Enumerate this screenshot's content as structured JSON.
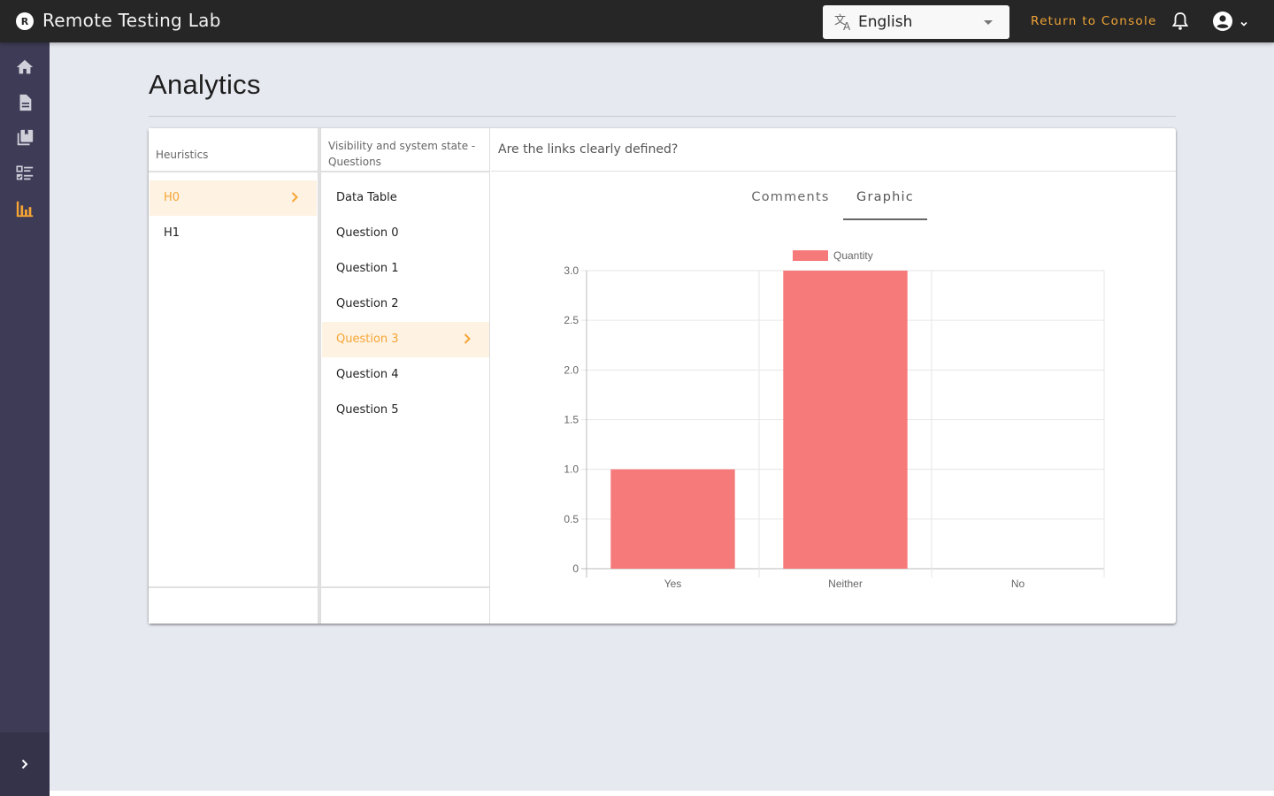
{
  "topbar": {
    "app_title": "Remote Testing Lab",
    "logo_letter": "R",
    "language": {
      "selected": "English",
      "icon": "translate-icon"
    },
    "return_link": "Return to Console",
    "icons": [
      "bell-icon",
      "account-circle-icon",
      "chevron-down-icon"
    ],
    "accent_color": "#f0a437"
  },
  "sidebar": {
    "items": [
      {
        "name": "home",
        "icon": "home-icon",
        "active": false
      },
      {
        "name": "document",
        "icon": "document-icon",
        "active": false
      },
      {
        "name": "library",
        "icon": "library-books-icon",
        "active": false
      },
      {
        "name": "checklist",
        "icon": "checklist-icon",
        "active": false
      },
      {
        "name": "analytics",
        "icon": "bar-chart-icon",
        "active": true
      }
    ],
    "expand_icon": "chevron-right-icon",
    "active_color": "#f6a534"
  },
  "page": {
    "title": "Analytics"
  },
  "heuristics": {
    "header": "Heuristics",
    "items": [
      {
        "label": "H0",
        "active": true
      },
      {
        "label": "H1",
        "active": false
      }
    ]
  },
  "questions": {
    "header": "Visibility and system state - Questions",
    "items": [
      {
        "label": "Data Table",
        "active": false
      },
      {
        "label": "Question 0",
        "active": false
      },
      {
        "label": "Question 1",
        "active": false
      },
      {
        "label": "Question 2",
        "active": false
      },
      {
        "label": "Question 3",
        "active": true
      },
      {
        "label": "Question 4",
        "active": false
      },
      {
        "label": "Question 5",
        "active": false
      }
    ]
  },
  "detail": {
    "question_title": "Are the links clearly defined?",
    "tabs": [
      {
        "label": "Comments",
        "active": false
      },
      {
        "label": "Graphic",
        "active": true
      }
    ]
  },
  "chart_data": {
    "type": "bar",
    "title": "",
    "categories": [
      "Yes",
      "Neither",
      "No"
    ],
    "series": [
      {
        "name": "Quantity",
        "values": [
          1,
          3,
          0
        ],
        "color": "#f67a7a"
      }
    ],
    "xlabel": "",
    "ylabel": "",
    "ylim": [
      0,
      3
    ],
    "yticks": [
      "0",
      "0.5",
      "1.0",
      "1.5",
      "2.0",
      "2.5",
      "3.0"
    ],
    "ytick_values": [
      0,
      0.5,
      1,
      1.5,
      2,
      2.5,
      3
    ],
    "grid": true,
    "legend": "top-center"
  }
}
